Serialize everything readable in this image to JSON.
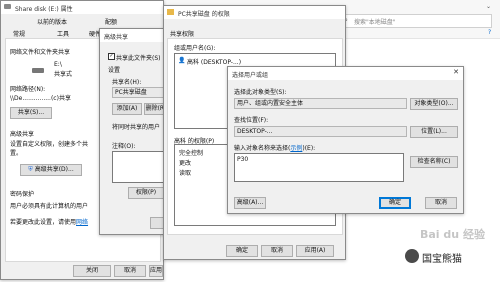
{
  "background_window": {
    "title_fragment": "文件",
    "search_placeholder": "搜索\"本地磁盘\""
  },
  "props_window": {
    "title": "Share disk (E:) 属性",
    "tabs_row1": [
      "以前的版本",
      "配额"
    ],
    "tabs_row2": [
      "常规",
      "工具",
      "硬件"
    ],
    "section_network": "网络文件和文件夹共享",
    "drive_label": "E:\\",
    "drive_status": "共享式",
    "network_path_label": "网络路径(N):",
    "network_path_value": "\\\\De...............(c)共享",
    "share_button": "共享(S)...",
    "advanced_section": "高级共享",
    "advanced_desc_1": "设置自定义权限，创建多个共",
    "advanced_desc_2": "置。",
    "advanced_share_button": "高级共享(D)...",
    "password_section": "密码保护",
    "password_desc": "用户必须具有此计算机的用户",
    "password_desc_2": "若要更改此设置，请使用",
    "password_link": "网络",
    "buttons": [
      "关闭",
      "取消",
      "应用(A)"
    ]
  },
  "adv_window": {
    "title": "高级共享",
    "share_checkbox": "共享此文件夹(S)",
    "settings_label": "设置",
    "share_name_label": "共享名(H):",
    "share_name_value": "PC共享磁盘",
    "add_button": "添加(A)",
    "remove_button": "删除(R)",
    "limit_label": "将同时共享的用户",
    "comment_label": "注释(O):",
    "permissions_button": "权限(P)"
  },
  "perm_window": {
    "title": "PC共享磁盘 的权限",
    "tab": "共享权限",
    "group_label": "组或用户名(G):",
    "group_item": "高科 (DESKTOP-...)",
    "perm_label": "高科 的权限(P)",
    "perm_rows": [
      "完全控制",
      "更改",
      "读取"
    ],
    "buttons": [
      "确定",
      "取消",
      "应用(A)"
    ]
  },
  "select_window": {
    "title": "选择用户或组",
    "object_type_label": "选择此对象类型(S):",
    "object_type_value": "用户、组或内置安全主体",
    "object_type_button": "对象类型(O)...",
    "location_label": "查找位置(F):",
    "location_value": "DESKTOP-...",
    "location_button": "位置(L)...",
    "names_label": "输入对象名称来选择(",
    "names_link": "示例",
    "names_label_tail": ")(E):",
    "names_value": "P30",
    "check_names_button": "检查名称(C)",
    "advanced_button": "高级(A)...",
    "ok_button": "确定",
    "cancel_button": "取消"
  },
  "watermark": {
    "text": "国宝熊猫",
    "baidu": "Bai du 经验"
  }
}
